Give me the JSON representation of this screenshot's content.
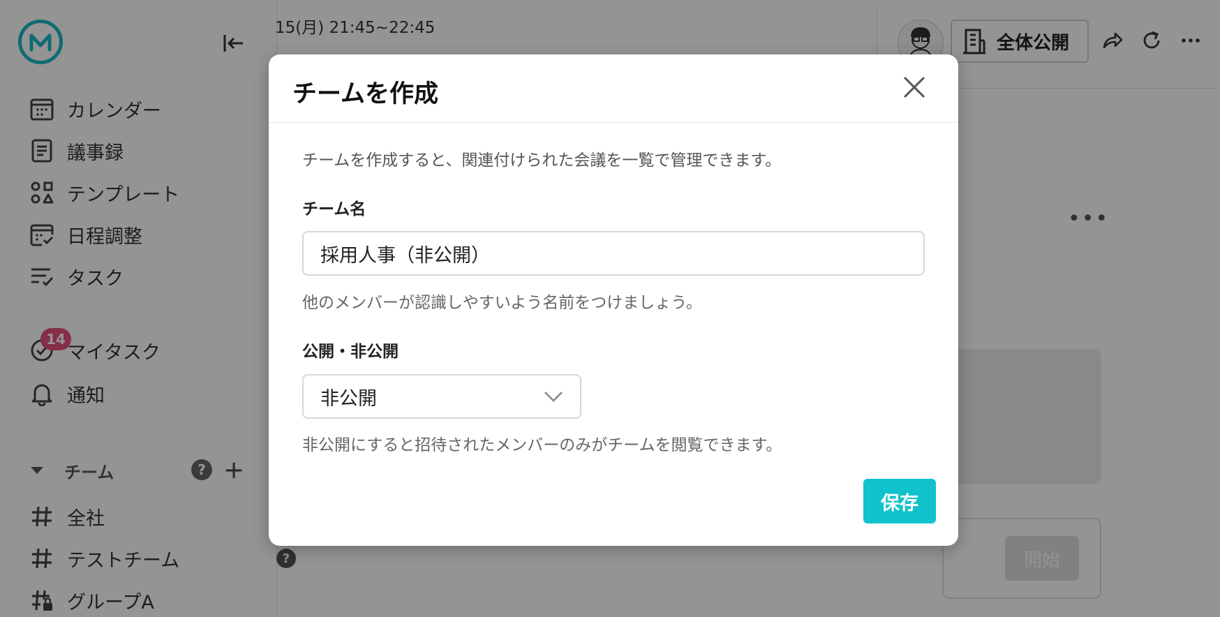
{
  "sidebar": {
    "items": [
      {
        "label": "カレンダー",
        "icon": "calendar-icon"
      },
      {
        "label": "議事録",
        "icon": "document-icon"
      },
      {
        "label": "テンプレート",
        "icon": "template-icon"
      },
      {
        "label": "日程調整",
        "icon": "schedule-check-icon"
      },
      {
        "label": "タスク",
        "icon": "task-list-icon"
      }
    ],
    "my_tasks": {
      "label": "マイタスク",
      "badge": "14"
    },
    "notifications": {
      "label": "通知"
    },
    "team_section": {
      "label": "チーム",
      "help": "?",
      "add": "+"
    },
    "teams": [
      {
        "label": "全社",
        "icon": "hash-icon"
      },
      {
        "label": "テストチーム",
        "icon": "hash-icon"
      },
      {
        "label": "グループA",
        "icon": "hash-lock-icon"
      }
    ]
  },
  "main": {
    "time": "15(月) 21:45~22:45",
    "public_label": "全体公開",
    "start_label": "開始",
    "more": "•••",
    "help": "?"
  },
  "modal": {
    "title": "チームを作成",
    "description": "チームを作成すると、関連付けられた会議を一覧で管理できます。",
    "name_label": "チーム名",
    "name_value": "採用人事（非公開）",
    "name_hint": "他のメンバーが認識しやすいよう名前をつけましょう。",
    "visibility_label": "公開・非公開",
    "visibility_value": "非公開",
    "visibility_hint": "非公開にすると招待されたメンバーのみがチームを閲覧できます。",
    "save_label": "保存"
  },
  "colors": {
    "accent": "#11c2cc",
    "badge": "#e3507a",
    "overlay": "rgba(0,0,0,0.42)"
  }
}
